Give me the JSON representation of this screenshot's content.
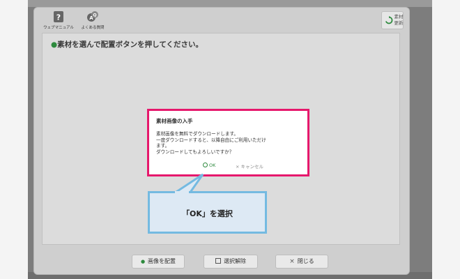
{
  "toolbar": {
    "manual_label": "ウェブマニュアル",
    "manual_icon": "question-icon",
    "faq_label": "よくある質問",
    "faq_icon": "faq-icon",
    "refresh_label_line1": "素材",
    "refresh_label_line2": "更新",
    "refresh_icon": "refresh-icon"
  },
  "instruction": {
    "bullet": "●",
    "text": "素材を選んで配置ボタンを押してください。"
  },
  "popup": {
    "title": "素材画像の入手",
    "body_lines": [
      "素材画像を無料でダウンロードします。",
      "一度ダウンロードすると、以降自由にご利用いただけ",
      "ます。",
      "ダウンロードしてもよろしいですか？"
    ],
    "ok_label": "OK",
    "cancel_label": "キャンセル",
    "cancel_mark": "×"
  },
  "callout": {
    "text": "「OK」を選択"
  },
  "bottom_buttons": {
    "place_label": "画像を配置",
    "place_icon_glyph": "●",
    "deselect_label": "選択解除",
    "close_label": "閉じる",
    "close_icon_glyph": "×"
  },
  "colors": {
    "highlight_border": "#e6186c",
    "callout_border": "#74bae1",
    "callout_fill": "#dde9f4",
    "accent_green": "#2e8a3e"
  }
}
